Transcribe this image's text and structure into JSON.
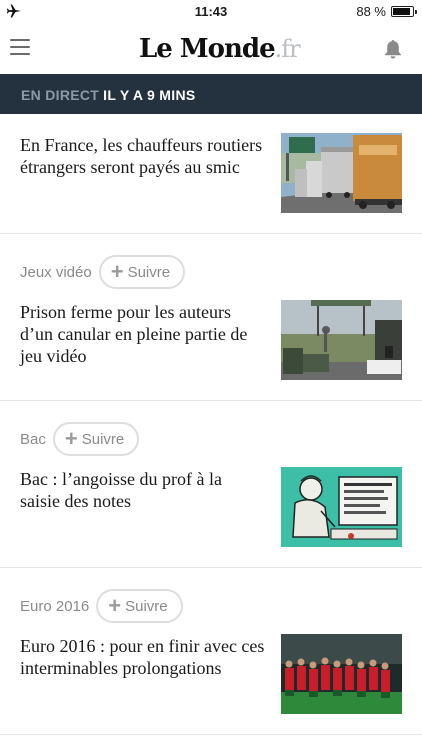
{
  "status_bar": {
    "time": "11:43",
    "battery_text": "88 %",
    "battery_level": 0.88,
    "airplane_icon": "airplane-icon"
  },
  "header": {
    "menu_icon": "hamburger-menu-icon",
    "logo_main": "Le Monde",
    "logo_suffix": ".fr",
    "notifications_icon": "bell-icon"
  },
  "live_banner": {
    "label": "EN DIRECT",
    "time_ago": "IL Y A 9 MINS"
  },
  "articles": [
    {
      "topic": "",
      "follow_label": "",
      "headline": "En France, les chauffeurs routiers étrangers seront payés au smic",
      "image_icon": "trucks-highway-photo"
    },
    {
      "topic": "Jeux vidéo",
      "follow_label": "Suivre",
      "headline": "Prison ferme pour les auteurs d’un canular en pleine partie de jeu vidéo",
      "image_icon": "police-checkpoint-photo"
    },
    {
      "topic": "Bac",
      "follow_label": "Suivre",
      "headline": "Bac : l’angoisse du prof à la saisie des notes",
      "image_icon": "cartoon-teacher-computer-illustration"
    },
    {
      "topic": "Euro 2016",
      "follow_label": "Suivre",
      "headline": "Euro 2016 : pour en finir avec ces interminables prolongations",
      "image_icon": "football-team-stadium-photo"
    }
  ],
  "colors": {
    "banner_bg": "#243240",
    "banner_muted": "#8d9aa6",
    "logo_suffix": "#b9bec3",
    "topic_gray": "#8a8a8a"
  }
}
